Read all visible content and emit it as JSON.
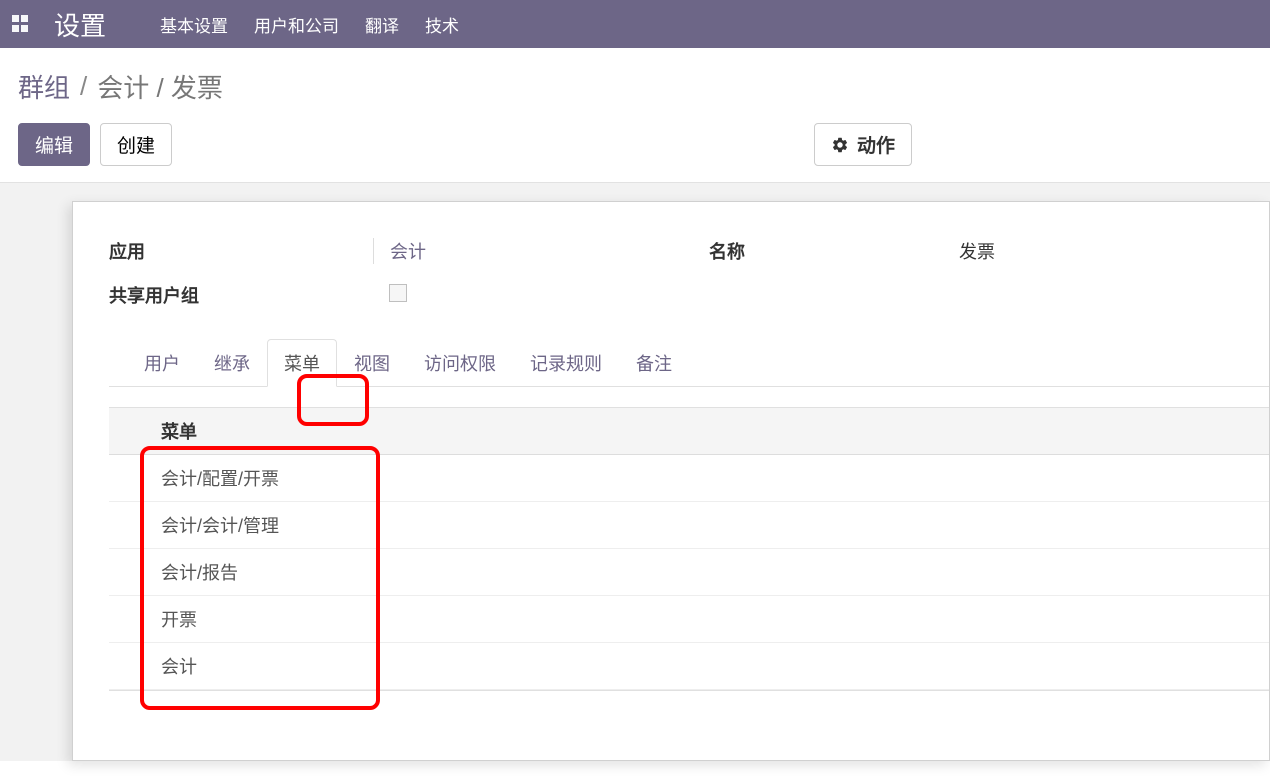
{
  "navbar": {
    "title": "设置",
    "menus": [
      "基本设置",
      "用户和公司",
      "翻译",
      "技术"
    ]
  },
  "breadcrumb": {
    "root": "群组",
    "current": "会计 / 发票"
  },
  "buttons": {
    "edit": "编辑",
    "create": "创建",
    "action": "动作"
  },
  "form": {
    "app_label": "应用",
    "app_value": "会计",
    "name_label": "名称",
    "name_value": "发票",
    "share_label": "共享用户组"
  },
  "tabs": [
    "用户",
    "继承",
    "菜单",
    "视图",
    "访问权限",
    "记录规则",
    "备注"
  ],
  "active_tab_index": 2,
  "table": {
    "header": "菜单",
    "rows": [
      "会计/配置/开票",
      "会计/会计/管理",
      "会计/报告",
      "开票",
      "会计"
    ]
  }
}
